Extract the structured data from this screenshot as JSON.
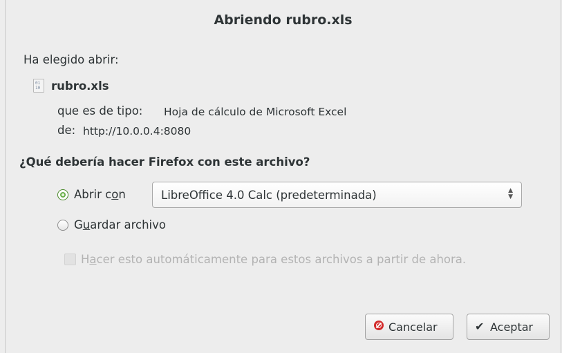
{
  "window": {
    "title": "Abriendo rubro.xls"
  },
  "intro": {
    "label": "Ha elegido abrir:"
  },
  "file": {
    "name": "rubro.xls",
    "icon": "spreadsheet-file-icon",
    "type_prefix": "que es de tipo:",
    "type_value": "Hoja de cálculo de Microsoft Excel",
    "from_prefix": "de:",
    "from_value": "http://10.0.0.4:8080"
  },
  "question": "¿Qué debería hacer Firefox con este archivo?",
  "options": {
    "open_with": {
      "label_a": "Abrir c",
      "label_u": "o",
      "label_b": "n",
      "checked": true
    },
    "app_select": {
      "value": "LibreOffice 4.0 Calc (predeterminada)"
    },
    "save_file": {
      "label_a": "G",
      "label_u": "u",
      "label_b": "ardar archivo",
      "checked": false
    },
    "auto": {
      "label_a": "H",
      "label_u": "a",
      "label_b": "cer esto automáticamente para estos archivos a partir de ahora.",
      "checked": false,
      "disabled": true
    }
  },
  "buttons": {
    "cancel": {
      "label": "Cancelar",
      "icon": "cancel-icon"
    },
    "ok": {
      "label": "Aceptar",
      "icon": "checkmark-icon"
    }
  },
  "colors": {
    "background": "#ededed",
    "radio_selected": "#6ab04c",
    "cancel_icon": "#d22a2a"
  }
}
